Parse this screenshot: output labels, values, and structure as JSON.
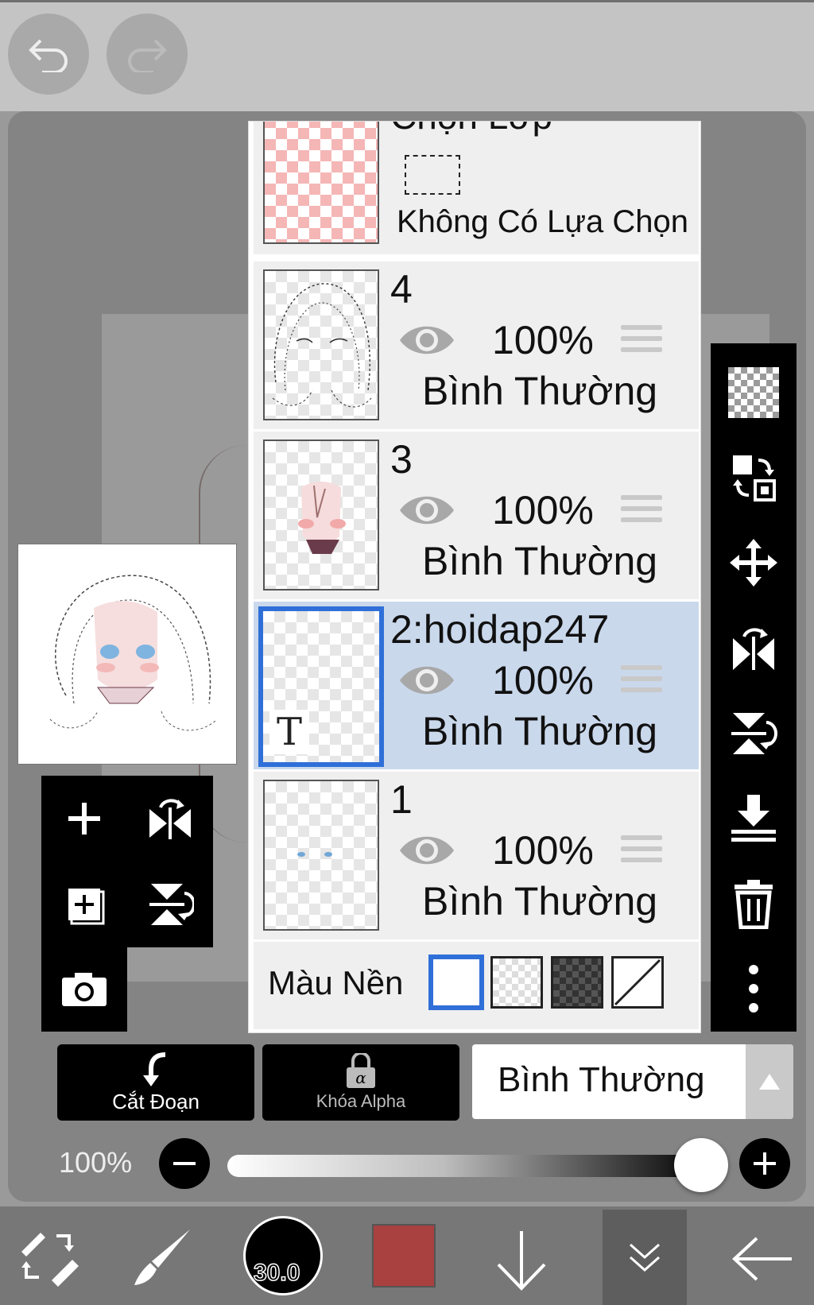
{
  "toolbar": {
    "undo_icon": "undo-arrow-icon",
    "redo_icon": "redo-arrow-icon"
  },
  "layers_panel": {
    "selection_layer": {
      "title": "Chọn Lớp",
      "status": "Không Có Lựa Chọn"
    },
    "layers": [
      {
        "name": "4",
        "opacity": "100%",
        "blend_mode": "Bình Thường",
        "selected": false
      },
      {
        "name": "3",
        "opacity": "100%",
        "blend_mode": "Bình Thường",
        "selected": false
      },
      {
        "name": "2:hoidap247",
        "opacity": "100%",
        "blend_mode": "Bình Thường",
        "selected": true,
        "type_label": "T"
      },
      {
        "name": "1",
        "opacity": "100%",
        "blend_mode": "Bình Thường",
        "selected": false
      }
    ],
    "background_label": "Màu Nền"
  },
  "left_tools": [
    "add-layer",
    "flip-horizontal",
    "add-layer-copy",
    "flip-vertical",
    "camera"
  ],
  "right_tools": [
    "transparency",
    "swap-layer",
    "move",
    "flip-horizontal",
    "flip-vertical",
    "merge-down",
    "delete",
    "more"
  ],
  "bottom_controls": {
    "clip_label": "Cắt Đoạn",
    "alpha_lock_label": "Khóa Alpha",
    "blend_mode": "Bình Thường",
    "opacity_label": "100%",
    "opacity_value": 1.0
  },
  "bottom_bar": {
    "brush_size": "30.0",
    "color": "#a8413f"
  },
  "colors": {
    "selected_border": "#2f6fd8",
    "selected_row": "#cad8ec"
  }
}
